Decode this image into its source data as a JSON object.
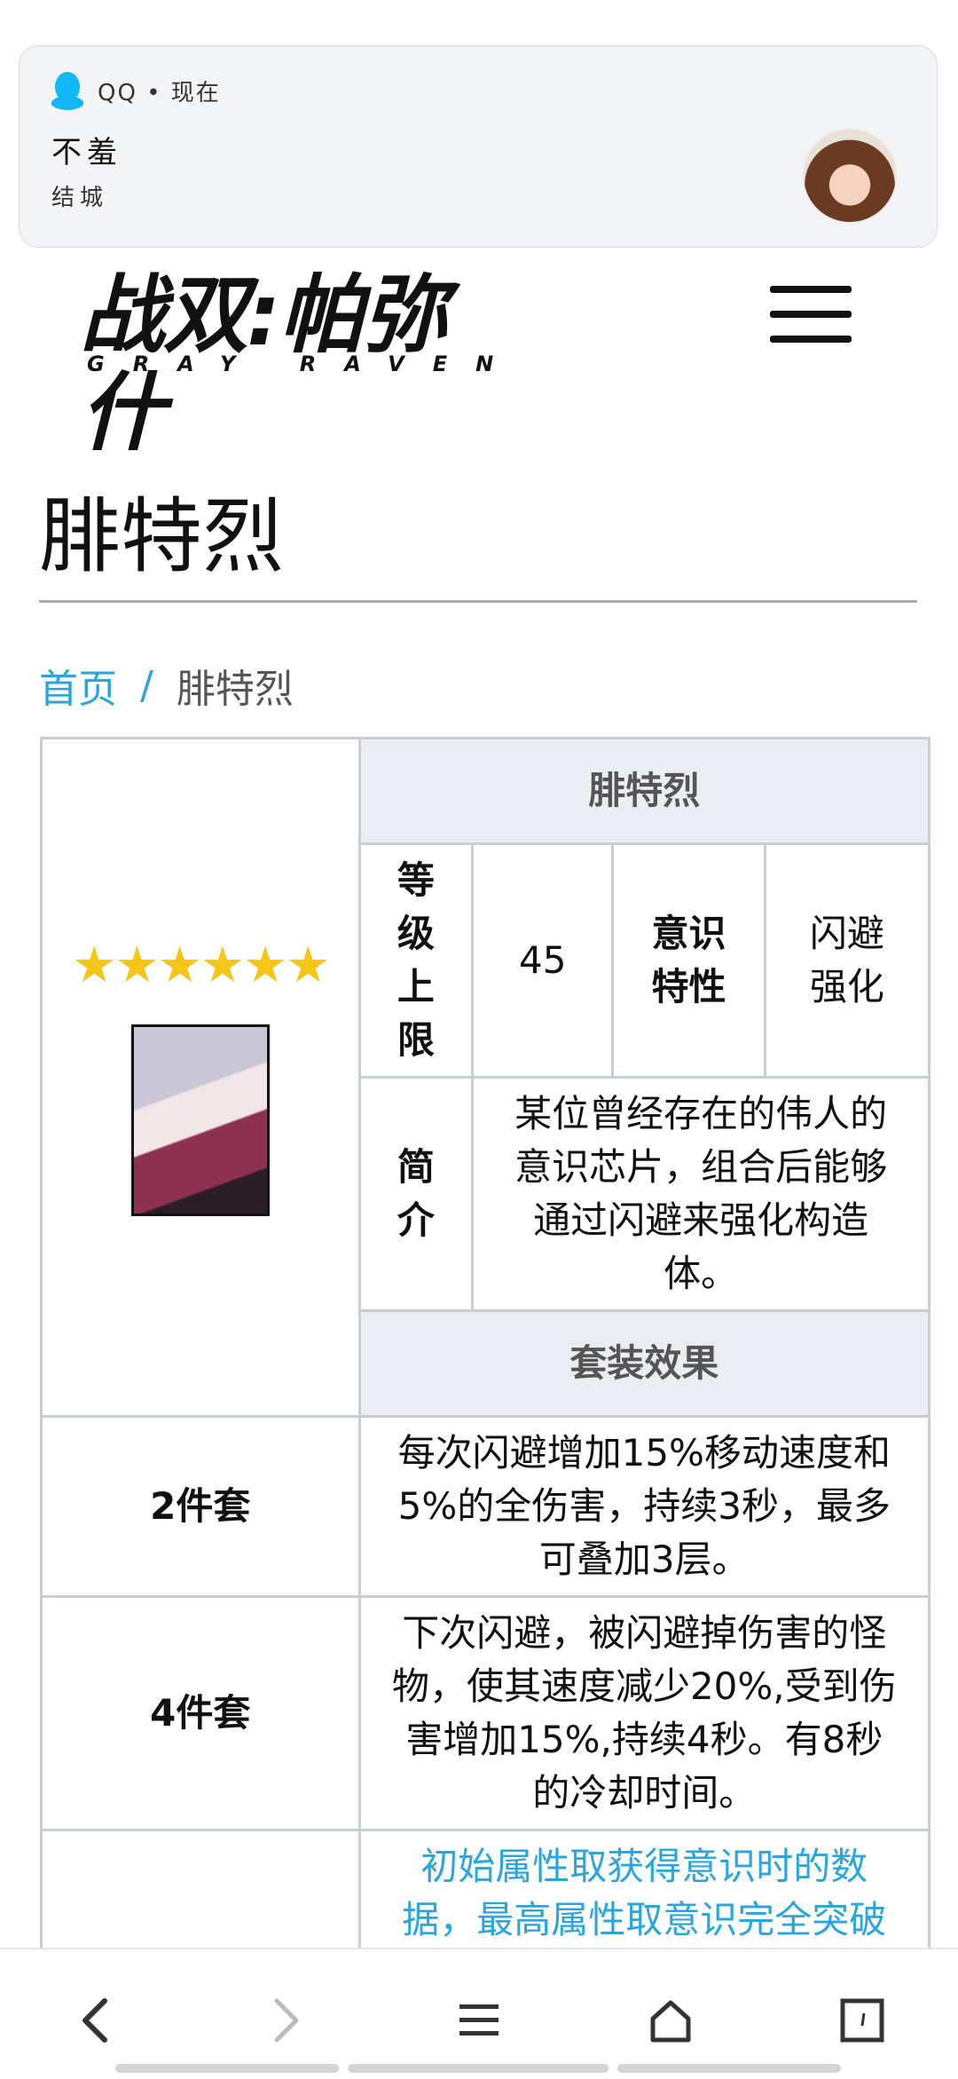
{
  "notification": {
    "app_line": "QQ • 现在",
    "title": "不羞",
    "subtitle": "结城"
  },
  "header": {
    "logo_cn": "战双:帕弥什",
    "logo_en": "GRAY RAVEN"
  },
  "page": {
    "title": "腓特烈"
  },
  "breadcrumb": {
    "home": "首页",
    "separator": "/",
    "current": "腓特烈"
  },
  "table": {
    "name_header": "腓特烈",
    "stars": "★★★★★★",
    "level_label": "等级上限",
    "level_value": "45",
    "trait_label": "意识特性",
    "trait_value": "闪避强化",
    "intro_label": "简介",
    "intro_text": "某位曾经存在的伟人的意识芯片，组合后能够通过闪避来强化构造体。",
    "set_effect_header": "套装效果",
    "set2_label": "2件套",
    "set2_text": "每次闪避增加15%移动速度和5%的全伤害，持续3秒，最多可叠加3层。",
    "set4_label": "4件套",
    "set4_text": "下次闪避，被闪避掉伤害的怪物，使其速度减少20%,受到伤害增加15%,持续4秒。有8秒的冷却时间。",
    "attr_note": "初始属性取获得意识时的数据，最高属性取意识完全突破"
  },
  "colors": {
    "link": "#2aa5dd",
    "star": "#f5c518",
    "header_bg": "#eaeef2",
    "border": "#c9ced6"
  },
  "icons": {
    "back": "chevron-left-icon",
    "forward": "chevron-right-icon",
    "menu": "menu-icon",
    "home": "home-icon",
    "tabs": "tabs-icon"
  }
}
